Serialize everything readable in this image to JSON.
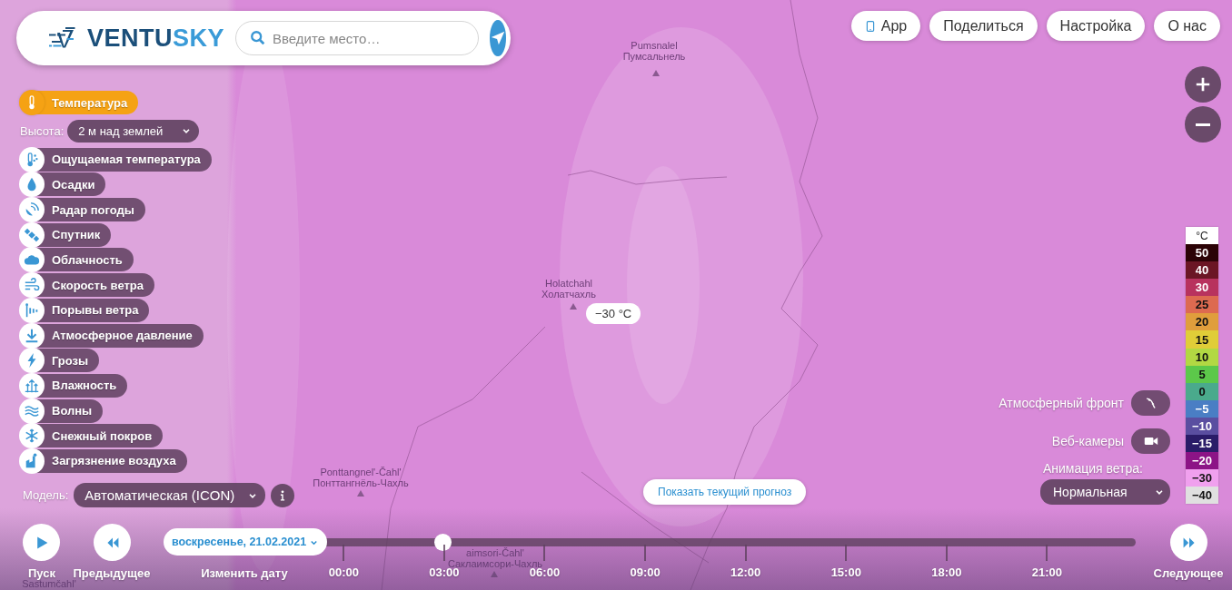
{
  "header": {
    "logo": {
      "part_1": "VENTU",
      "part_2": "SKY"
    },
    "search": {
      "placeholder": "Введите место…"
    }
  },
  "nav": [
    {
      "label": "App",
      "kind": "app"
    },
    {
      "label": "Поделиться",
      "kind": "plain"
    },
    {
      "label": "Настройка",
      "kind": "plain"
    },
    {
      "label": "О нас",
      "kind": "plain"
    }
  ],
  "layers": [
    {
      "label": "Температура",
      "kind": "thermometer",
      "selected": true
    },
    {
      "label": "Ощущаемая температура",
      "kind": "feels",
      "selected": false
    },
    {
      "label": "Осадки",
      "kind": "drop",
      "selected": false
    },
    {
      "label": "Радар погоды",
      "kind": "radar",
      "selected": false
    },
    {
      "label": "Спутник",
      "kind": "satellite",
      "selected": false
    },
    {
      "label": "Облачность",
      "kind": "cloud",
      "selected": false
    },
    {
      "label": "Скорость ветра",
      "kind": "wind",
      "selected": false
    },
    {
      "label": "Порывы ветра",
      "kind": "gusts",
      "selected": false
    },
    {
      "label": "Атмосферное давление",
      "kind": "pressure",
      "selected": false
    },
    {
      "label": "Грозы",
      "kind": "storm",
      "selected": false
    },
    {
      "label": "Влажность",
      "kind": "humidity",
      "selected": false
    },
    {
      "label": "Волны",
      "kind": "waves",
      "selected": false
    },
    {
      "label": "Снежный покров",
      "kind": "snow",
      "selected": false
    },
    {
      "label": "Загрязнение воздуха",
      "kind": "pollution",
      "selected": false
    }
  ],
  "height": {
    "label": "Высота:",
    "value": "2 м над землей"
  },
  "model": {
    "label": "Модель:",
    "value": "Автоматическая (ICON)"
  },
  "map": {
    "places": [
      {
        "name_latin": "Pumsnalel",
        "name_cyrillic": "Пумсальнель"
      },
      {
        "name_latin": "Holatchahl",
        "name_cyrillic": "Холатчахль"
      },
      {
        "name_latin": "Ponttangnel'-Čahl'",
        "name_cyrillic": "Понттангнёль-Чахль"
      },
      {
        "name_latin": "aimsori-Čahl'",
        "name_cyrillic": "Саклаимсори-Чахль"
      },
      {
        "name_latin": "Sastumčahl'"
      }
    ],
    "marker": "−30 °C",
    "forecast_button": "Показать текущий прогноз"
  },
  "overlays": [
    {
      "label": "Атмосферный фронт",
      "kind": "front",
      "on": false
    },
    {
      "label": "Веб-камеры",
      "kind": "webcam",
      "on": false
    }
  ],
  "wind_animation": {
    "label": "Анимация ветра:",
    "value": "Нормальная"
  },
  "legend": {
    "unit": "°C",
    "steps": [
      {
        "label": "50",
        "color": "#2b0306"
      },
      {
        "label": "40",
        "color": "#6b1624"
      },
      {
        "label": "30",
        "color": "#b8325e"
      },
      {
        "label": "25",
        "color": "#dd6a50"
      },
      {
        "label": "20",
        "color": "#e09e3c"
      },
      {
        "label": "15",
        "color": "#e0cd38"
      },
      {
        "label": "10",
        "color": "#b2d843"
      },
      {
        "label": "5",
        "color": "#5cc84a"
      },
      {
        "label": "0",
        "color": "#4aaa8c"
      },
      {
        "label": "−5",
        "color": "#4a7ec4"
      },
      {
        "label": "−10",
        "color": "#5a4ea0"
      },
      {
        "label": "−15",
        "color": "#2a1c68"
      },
      {
        "label": "−20",
        "color": "#8c1486"
      },
      {
        "label": "−30",
        "color": "#f0a0ee"
      },
      {
        "label": "−40",
        "color": "#e0e0e0"
      }
    ]
  },
  "timeline": {
    "play": "Пуск",
    "previous": "Предыдущее",
    "date": "воскресенье, 21.02.2021",
    "change_date": "Изменить дату",
    "next": "Следующее",
    "level": 0.149,
    "ticks": [
      "00:00",
      "03:00",
      "06:00",
      "09:00",
      "12:00",
      "15:00",
      "18:00",
      "21:00"
    ]
  }
}
